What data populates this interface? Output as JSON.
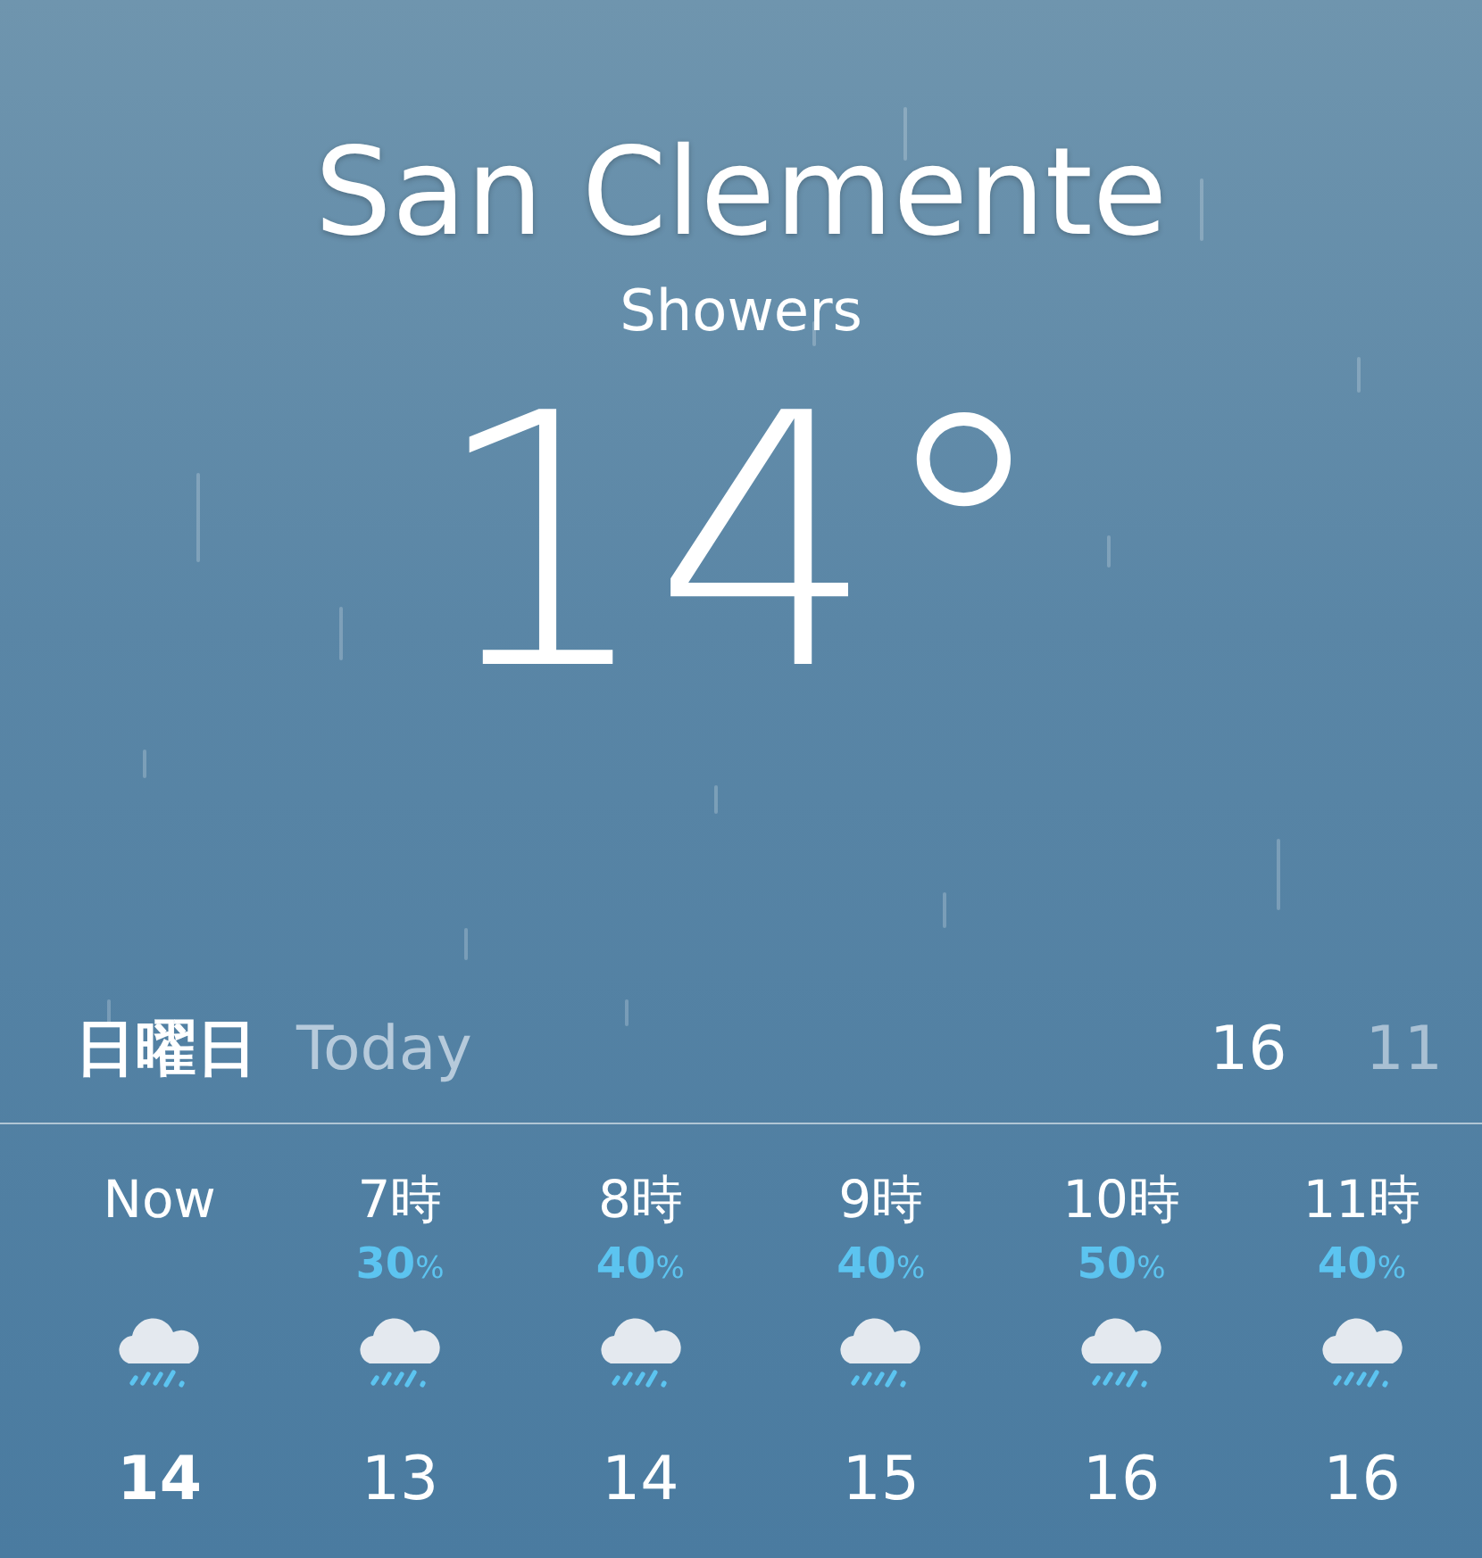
{
  "location": {
    "city": "San Clemente",
    "condition": "Showers",
    "temperature": "14°"
  },
  "day": {
    "weekday": "日曜日",
    "label": "Today",
    "high": "16",
    "low": "11"
  },
  "hourly": [
    {
      "time": "Now",
      "temp": "14",
      "current": true
    },
    {
      "time": "7時",
      "chance": "30",
      "unit": "%",
      "temp": "13",
      "current": false
    },
    {
      "time": "8時",
      "chance": "40",
      "unit": "%",
      "temp": "14",
      "current": false
    },
    {
      "time": "9時",
      "chance": "40",
      "unit": "%",
      "temp": "15",
      "current": false
    },
    {
      "time": "10時",
      "chance": "50",
      "unit": "%",
      "temp": "16",
      "current": false
    },
    {
      "time": "11時",
      "chance": "40",
      "unit": "%",
      "temp": "16",
      "current": false
    }
  ]
}
